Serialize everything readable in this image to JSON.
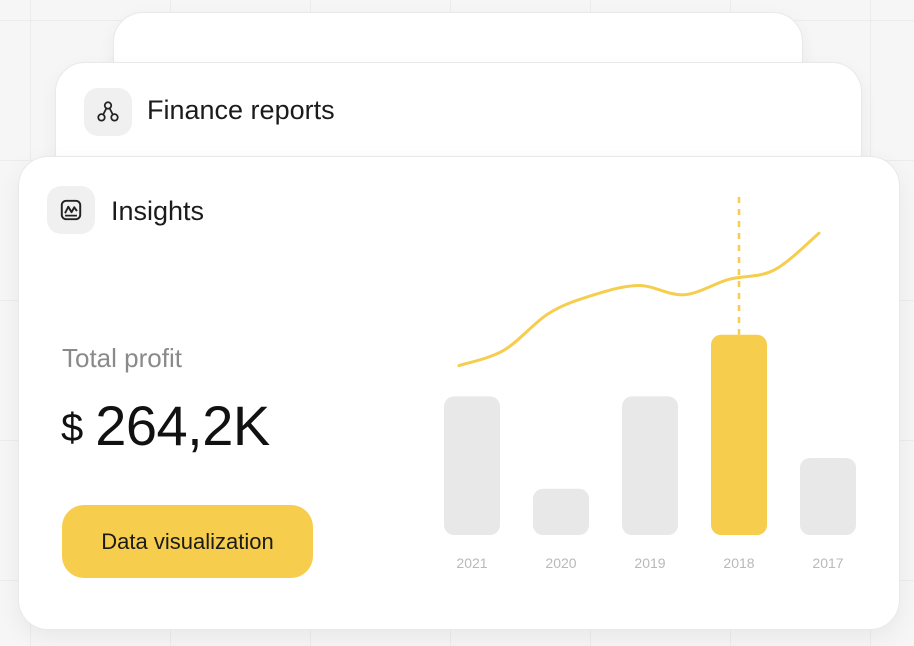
{
  "cards": {
    "finance": {
      "title": "Finance reports",
      "icon": "share-nodes-icon"
    },
    "insights": {
      "title": "Insights",
      "icon": "chart-box-icon"
    }
  },
  "summary": {
    "label": "Total profit",
    "currency": "$",
    "value": "264,2K"
  },
  "cta": {
    "label": "Data visualization"
  },
  "colors": {
    "accent": "#f6cd4d",
    "bar_inactive": "#e8e8e8",
    "tick_text": "#b9b9b9"
  },
  "chart_data": {
    "type": "bar",
    "categories": [
      "2021",
      "2020",
      "2019",
      "2018",
      "2017"
    ],
    "values": [
      45,
      15,
      45,
      65,
      25
    ],
    "highlight_index": 3,
    "ylim": [
      0,
      100
    ],
    "trend_line": {
      "type": "line",
      "values": [
        55,
        60,
        72,
        78,
        81,
        78,
        83,
        86,
        98
      ]
    },
    "title": "",
    "xlabel": "",
    "ylabel": "",
    "grid": false,
    "legend": "none"
  }
}
